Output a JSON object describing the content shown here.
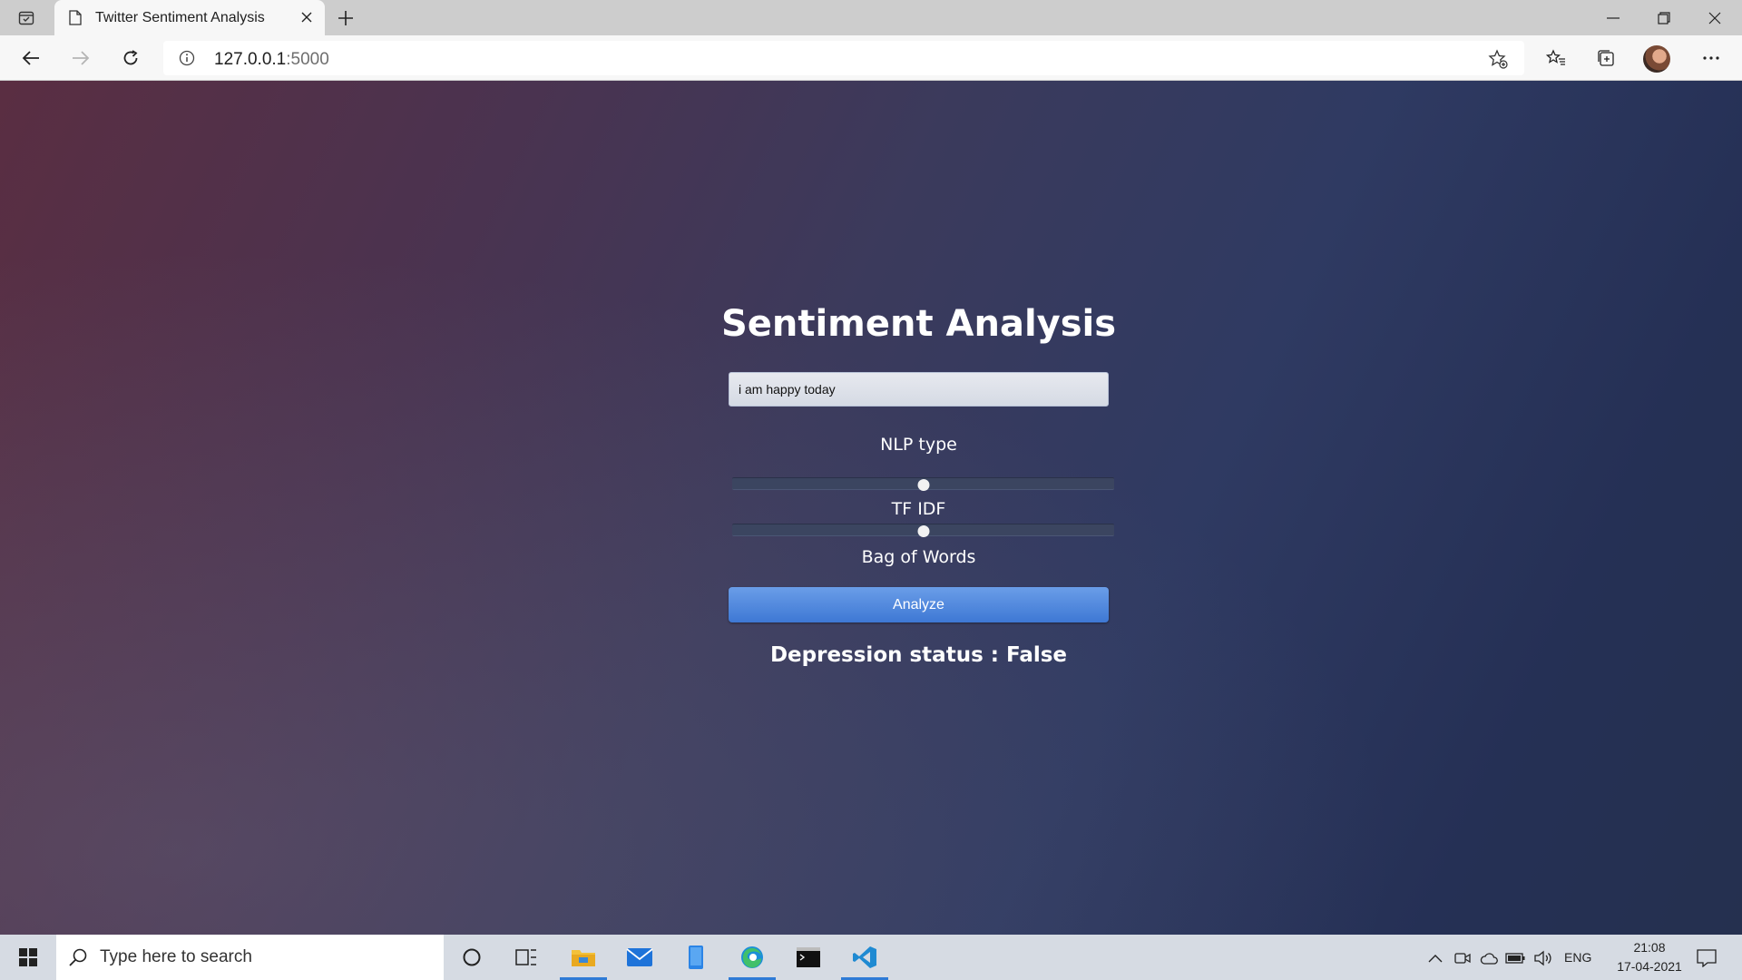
{
  "browser": {
    "tab_title": "Twitter Sentiment Analysis",
    "url_host": "127.0.0.1",
    "url_port": ":5000"
  },
  "page": {
    "heading": "Sentiment Analysis",
    "input_value": "i am happy today",
    "nlp_type_label": "NLP type",
    "slider_option_1": "TF IDF",
    "slider_option_2": "Bag of Words",
    "slider_1_value": 0.5,
    "slider_2_value": 0.5,
    "analyze_button": "Analyze",
    "result_text": "Depression status : False"
  },
  "taskbar": {
    "search_placeholder": "Type here to search",
    "language": "ENG",
    "time": "21:08",
    "date": "17-04-2021"
  },
  "colors": {
    "accent": "#3e78d4",
    "taskbar_active": "#2f7bd6"
  }
}
